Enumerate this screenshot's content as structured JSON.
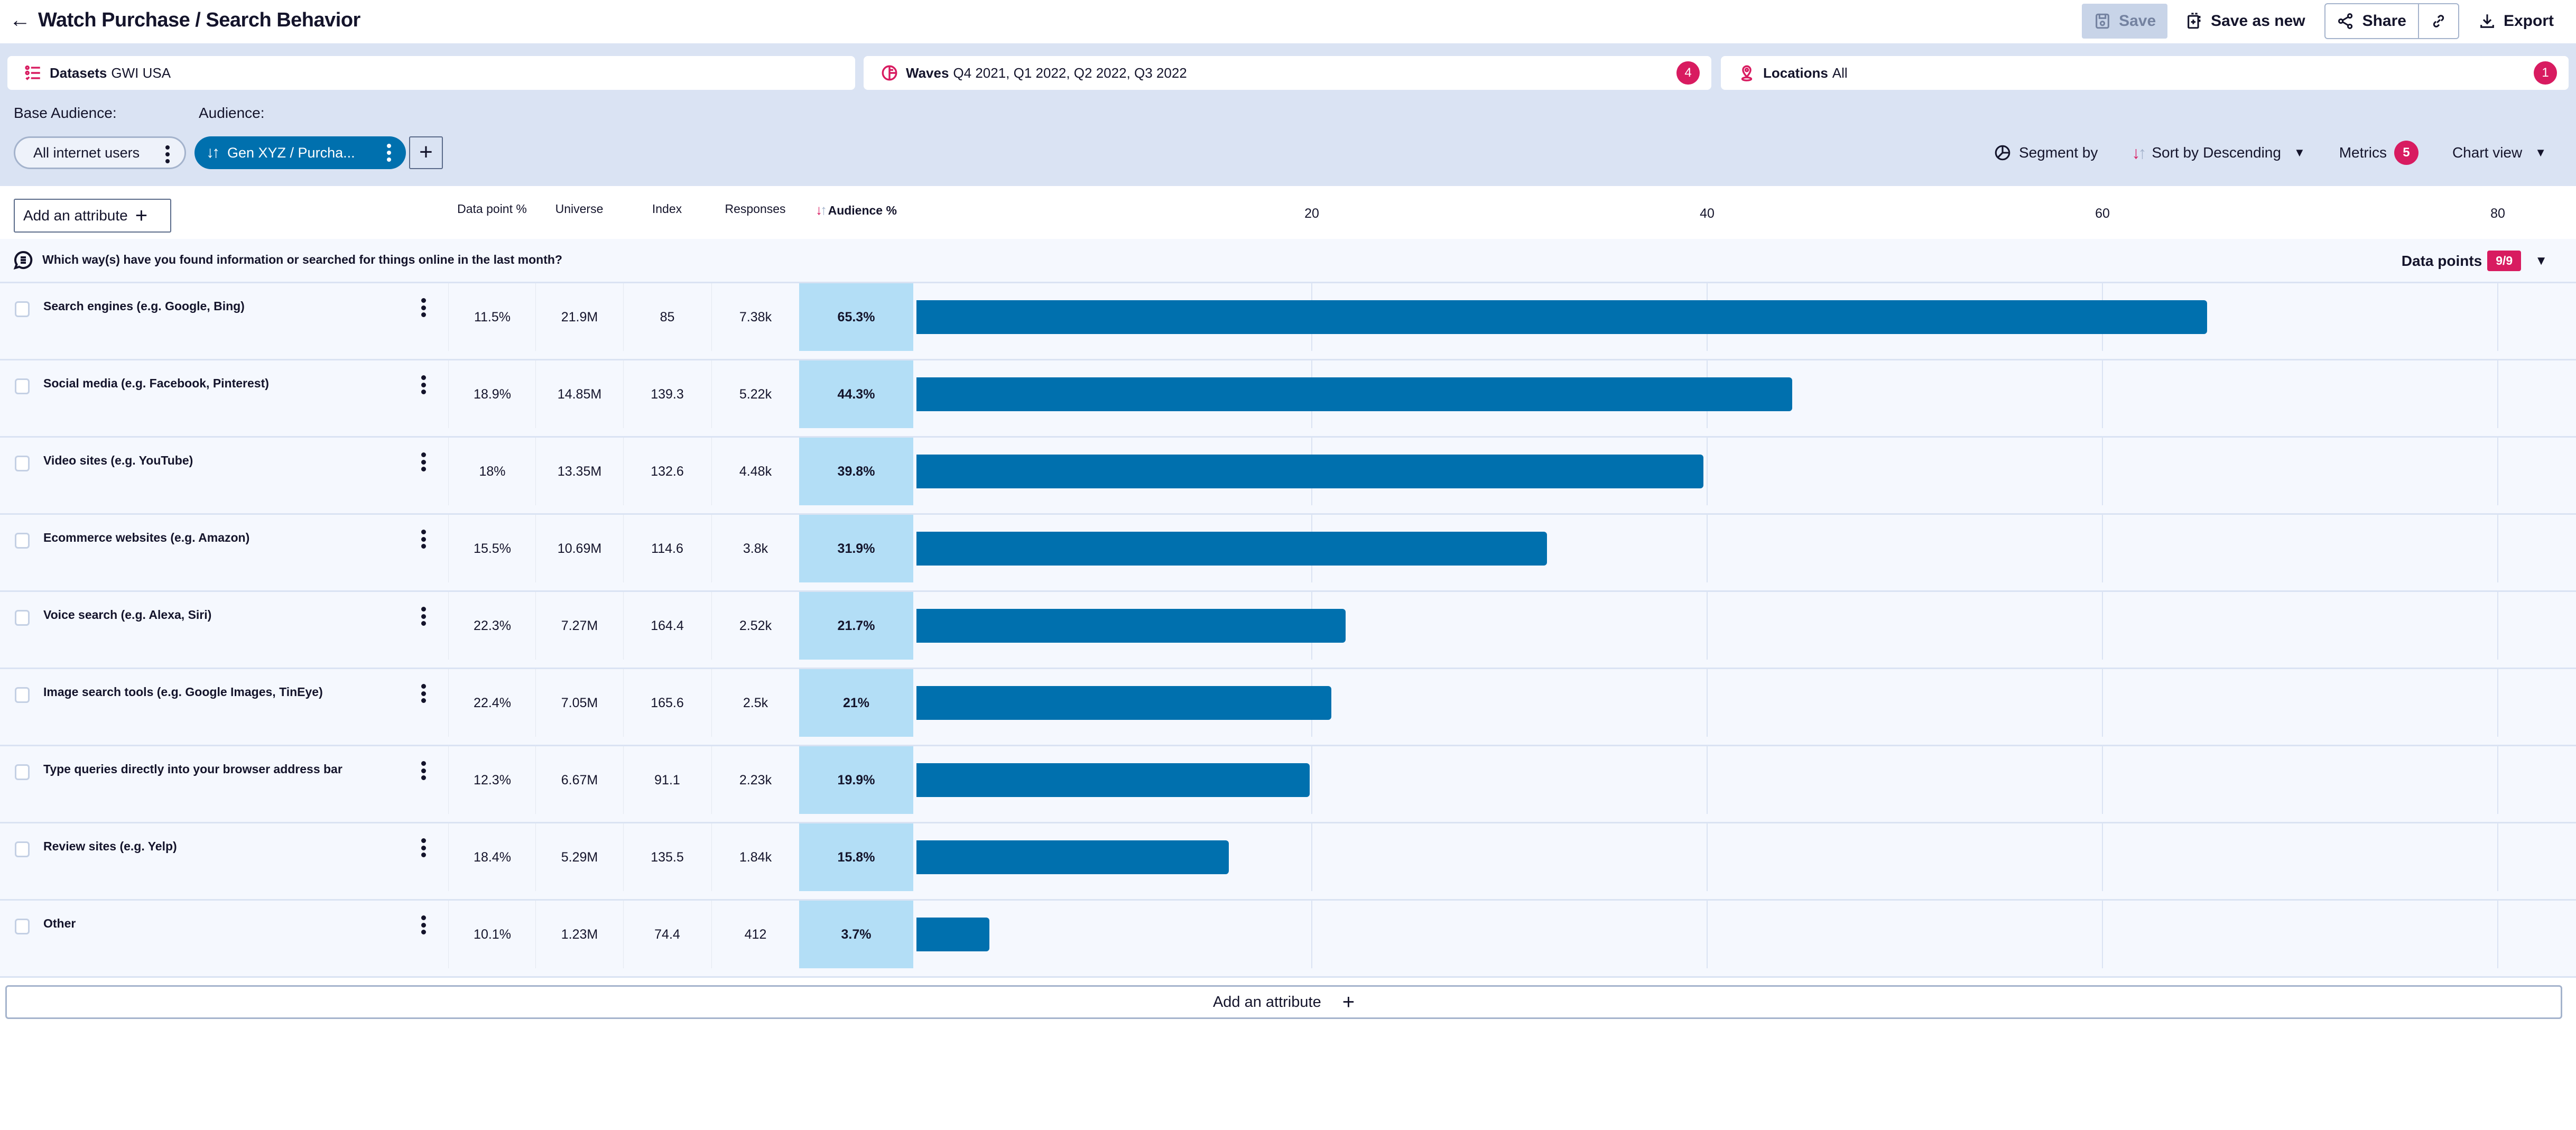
{
  "header": {
    "title": "Watch Purchase / Search Behavior",
    "back_icon": "arrow-left-icon",
    "actions": {
      "save": "Save",
      "save_as_new": "Save as new",
      "share": "Share",
      "export": "Export"
    }
  },
  "filters": {
    "datasets": {
      "label": "Datasets",
      "value": "GWI USA",
      "icon": "checklist-icon"
    },
    "waves": {
      "label": "Waves",
      "value": "Q4 2021, Q1 2022, Q2 2022, Q3 2022",
      "count": "4",
      "icon": "waves-icon"
    },
    "locations": {
      "label": "Locations",
      "value": "All",
      "count": "1",
      "icon": "location-pin-icon"
    }
  },
  "audience_bar": {
    "base_label": "Base Audience:",
    "audience_label": "Audience:",
    "base_chip": "All internet users",
    "audience_chip": "Gen XYZ / Purcha...",
    "add_audience": "+"
  },
  "toolbar": {
    "segment_by": "Segment by",
    "sort_by_label": "Sort by",
    "sort_by_value": "Descending",
    "metrics": "Metrics",
    "metrics_count": "5",
    "chart_view": "Chart view"
  },
  "table": {
    "add_attribute": "Add an attribute",
    "columns": [
      "Data point %",
      "Universe",
      "Index",
      "Responses",
      "Audience %"
    ],
    "question": "Which way(s) have you found information or searched for things online in the last month?",
    "data_points_label": "Data points",
    "data_points_value": "9/9",
    "add_attribute_bottom": "Add an attribute"
  },
  "colors": {
    "accent": "#d81b60",
    "bar": "#0070ae",
    "audience_col": "#b3def6",
    "band": "#dae3f3"
  },
  "chart_data": {
    "type": "bar",
    "orientation": "horizontal",
    "title": "Which way(s) have you found information or searched for things online in the last month?",
    "xlabel": "Audience %",
    "ylabel": "",
    "xlim": [
      0,
      80
    ],
    "x_ticks": [
      "20",
      "40",
      "60",
      "80"
    ],
    "grid": true,
    "categories": [
      "Search engines (e.g. Google, Bing)",
      "Social media (e.g. Facebook, Pinterest)",
      "Video sites (e.g. YouTube)",
      "Ecommerce websites (e.g. Amazon)",
      "Voice search (e.g. Alexa, Siri)",
      "Image search tools (e.g. Google Images, TinEye)",
      "Type queries directly into your browser address bar",
      "Review sites (e.g. Yelp)",
      "Other"
    ],
    "values": [
      65.3,
      44.3,
      39.8,
      31.9,
      21.7,
      21.0,
      19.9,
      15.8,
      3.7
    ],
    "rows": [
      {
        "label": "Search engines (e.g. Google, Bing)",
        "data_point": "11.5%",
        "universe": "21.9M",
        "index": "85",
        "responses": "7.38k",
        "audience": "65.3%",
        "value": 65.3
      },
      {
        "label": "Social media (e.g. Facebook, Pinterest)",
        "data_point": "18.9%",
        "universe": "14.85M",
        "index": "139.3",
        "responses": "5.22k",
        "audience": "44.3%",
        "value": 44.3
      },
      {
        "label": "Video sites (e.g. YouTube)",
        "data_point": "18%",
        "universe": "13.35M",
        "index": "132.6",
        "responses": "4.48k",
        "audience": "39.8%",
        "value": 39.8
      },
      {
        "label": "Ecommerce websites (e.g. Amazon)",
        "data_point": "15.5%",
        "universe": "10.69M",
        "index": "114.6",
        "responses": "3.8k",
        "audience": "31.9%",
        "value": 31.9
      },
      {
        "label": "Voice search (e.g. Alexa, Siri)",
        "data_point": "22.3%",
        "universe": "7.27M",
        "index": "164.4",
        "responses": "2.52k",
        "audience": "21.7%",
        "value": 21.7
      },
      {
        "label": "Image search tools (e.g. Google Images, TinEye)",
        "data_point": "22.4%",
        "universe": "7.05M",
        "index": "165.6",
        "responses": "2.5k",
        "audience": "21%",
        "value": 21.0
      },
      {
        "label": "Type queries directly into your browser address bar",
        "data_point": "12.3%",
        "universe": "6.67M",
        "index": "91.1",
        "responses": "2.23k",
        "audience": "19.9%",
        "value": 19.9
      },
      {
        "label": "Review sites (e.g. Yelp)",
        "data_point": "18.4%",
        "universe": "5.29M",
        "index": "135.5",
        "responses": "1.84k",
        "audience": "15.8%",
        "value": 15.8
      },
      {
        "label": "Other",
        "data_point": "10.1%",
        "universe": "1.23M",
        "index": "74.4",
        "responses": "412",
        "audience": "3.7%",
        "value": 3.7
      }
    ]
  }
}
